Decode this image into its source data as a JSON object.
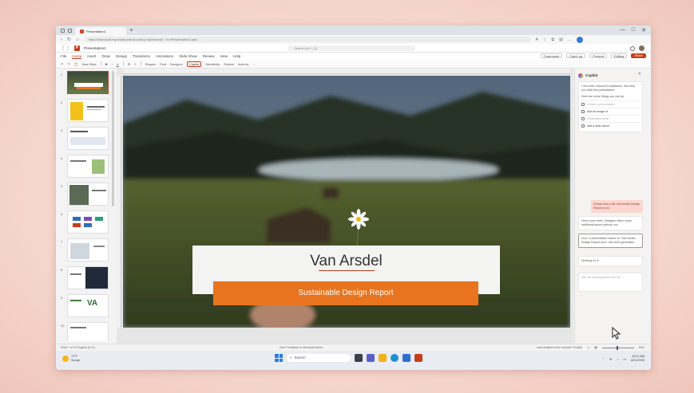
{
  "browser": {
    "tab_title": "Presentation1",
    "new_tab": "+",
    "url": "https://microsoft-my.sharepoint.df.com/:p:/r/personal/...?e=Presentation1.pptx",
    "window_controls": [
      "—",
      "□",
      "✕"
    ]
  },
  "office": {
    "doc_name": "Presentation1",
    "search_placeholder": "Search (Alt + Q)"
  },
  "ribbon": {
    "tabs": [
      "File",
      "Home",
      "Insert",
      "Draw",
      "Design",
      "Transitions",
      "Animations",
      "Slide Show",
      "Review",
      "View",
      "Help"
    ],
    "active_tab": "Home",
    "right_buttons": [
      "Comments",
      "Catch up",
      "Present",
      "Editing"
    ],
    "share": "Share"
  },
  "toolbar": {
    "items": [
      "New Slide",
      "Shapes",
      "Find",
      "Designer",
      "Copilot",
      "Sensitivity",
      "Dictate",
      "Add-ins"
    ]
  },
  "slides": {
    "count": 10,
    "numbers": [
      "1",
      "2",
      "3",
      "4",
      "5",
      "6",
      "7",
      "8",
      "9",
      "10"
    ]
  },
  "slide": {
    "title": "Van Arsdel",
    "subtitle": "Sustainable Design Report"
  },
  "copilot": {
    "title": "Copilot",
    "intro": "I can chat, respond to questions, and help you draft this presentation.",
    "prompt_header": "Here are some things you can try:",
    "suggestions": [
      {
        "label": "Create a presentation",
        "muted": true
      },
      {
        "label": "Add an image of",
        "muted": false
      },
      {
        "label": "Understand what",
        "muted": true
      },
      {
        "label": "Add a slide about",
        "muted": false
      }
    ],
    "user_message": "Create from a file Van Arsdel Design Report.d ocx",
    "reply1": "Here's your deck. Designer offers some additional layout options, too.",
    "reply2": "Sure. A presentation based on \"Van Arsdel Design Report.docx\" has been generated",
    "working": "Working on it...",
    "input_placeholder": "Ask me anything about this file..."
  },
  "statusbar": {
    "left": "Slide 1 of 10   English (U.S.)",
    "center": "Give Feedback to Microsoft   Notes",
    "right": "Last updated a few minutes   Fit slide",
    "zoom": "63%"
  },
  "taskbar": {
    "temp": "72°F",
    "weather": "Sunny",
    "search": "Search",
    "time": "10:11 AM",
    "date": "6/21/2023"
  }
}
